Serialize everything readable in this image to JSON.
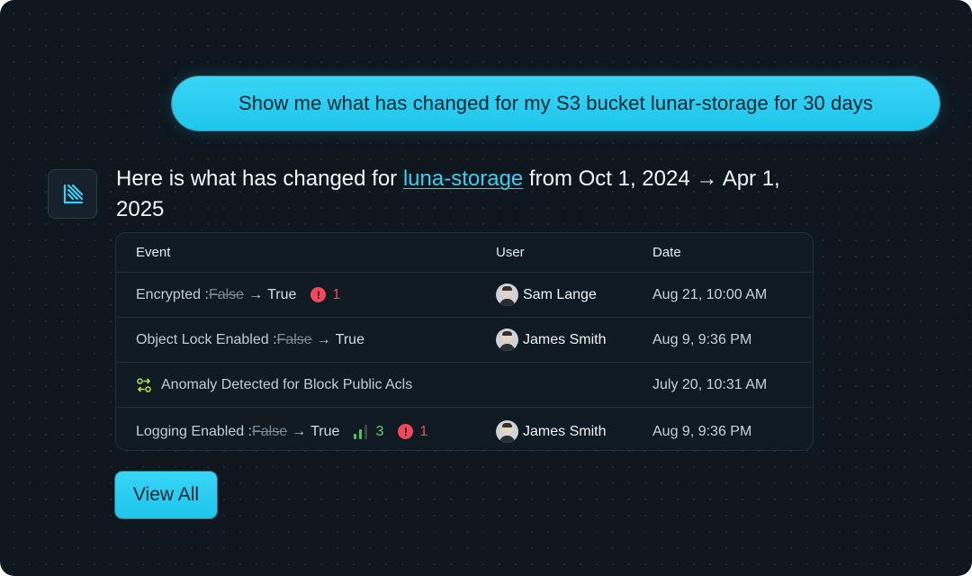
{
  "prompt": "Show me what has changed for my S3 bucket lunar-storage for 30 days",
  "reply": {
    "prefix": "Here is what has changed for ",
    "link": "luna-storage",
    "suffix": " from Oct 1, 2024 → Apr 1, 2025"
  },
  "table": {
    "headers": {
      "event": "Event",
      "user": "User",
      "date": "Date"
    },
    "rows": [
      {
        "label": "Encrypted : ",
        "old": "False",
        "arrow": "→",
        "new": "True",
        "alert": "1",
        "user": "Sam Lange",
        "date": "Aug 21, 10:00 AM"
      },
      {
        "label": "Object Lock Enabled : ",
        "old": "False",
        "arrow": "→",
        "new": "True",
        "user": "James Smith",
        "date": "Aug 9, 9:36 PM"
      },
      {
        "label": "Anomaly Detected for Block Public Acls",
        "user": "",
        "date": "July 20, 10:31 AM"
      },
      {
        "label": "Logging Enabled : ",
        "old": "False",
        "arrow": "→",
        "new": "True",
        "signal": "3",
        "alert": "1",
        "user": "James Smith",
        "date": "Aug 9, 9:36 PM"
      }
    ]
  },
  "view_all": "View All",
  "colors": {
    "accent": "#1ec6ec",
    "alert": "#ef4a5c",
    "success": "#45c95b",
    "background": "#0e161e"
  },
  "icons": {
    "assistant": "luna-logo-icon",
    "anomaly": "anomaly-swap-icon",
    "alert": "alert-circle-icon",
    "signal": "signal-bars-icon"
  }
}
